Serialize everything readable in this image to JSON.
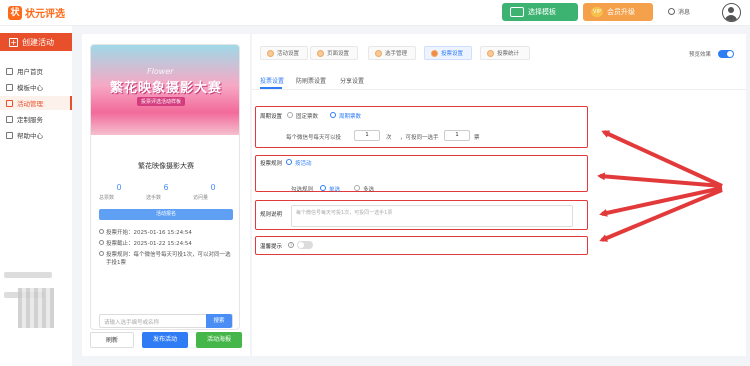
{
  "brand": {
    "name": "状元评选",
    "mark": "状"
  },
  "topbar": {
    "template_btn": "选择模板",
    "vip_btn": "会员升级",
    "vip_badge": "VIP",
    "messages": "消息"
  },
  "sidebar": {
    "create": "创建活动",
    "items": [
      {
        "label": "用户首页"
      },
      {
        "label": "模板中心"
      },
      {
        "label": "活动管理"
      },
      {
        "label": "定制服务"
      },
      {
        "label": "帮助中心"
      }
    ]
  },
  "preview": {
    "flower_text": "Flower",
    "banner_title": "繁花映象摄影大赛",
    "banner_sub": "投票评选活动样板",
    "card_title": "繁花映像摄影大赛",
    "stats": [
      {
        "num": "0",
        "label": "总票数"
      },
      {
        "num": "6",
        "label": "选手数"
      },
      {
        "num": "0",
        "label": "访问量"
      }
    ],
    "vote_btn": "活动报名",
    "start": "投票开始：2025-01-16 15:24:54",
    "end": "投票截止：2025-01-22 15:24:54",
    "rule": "投票规则：每个微信号每天可投1次，可以对同一选手投1票",
    "search_placeholder": "请输入选手编号或名称",
    "search_btn": "搜索",
    "tabs": [
      "首页",
      "排名",
      "我的",
      "规则"
    ]
  },
  "actions": {
    "refresh": "刷新",
    "publish": "发布活动",
    "poster": "活动海报"
  },
  "steps": [
    {
      "label": "活动设置"
    },
    {
      "label": "页面设置"
    },
    {
      "label": "选手管理"
    },
    {
      "label": "投票设置"
    },
    {
      "label": "投票统计"
    }
  ],
  "preview_toggle": "预览效果",
  "subtabs": [
    "投票设置",
    "防刷票设置",
    "分享设置"
  ],
  "form": {
    "cycle_label": "周期设置",
    "cycle_fixed": "固定票数",
    "cycle_period": "周期票数",
    "per_prefix": "每个微信号每天可以投",
    "per_value": "1",
    "per_unit": "次",
    "per_mid": "，可投同一选手",
    "same_value": "1",
    "same_unit": "票",
    "rule_label": "投票规则",
    "rule_option": "按活动",
    "check_label": "勾选规则",
    "single": "单选",
    "multi": "多选",
    "desc_label": "规则说明",
    "desc_placeholder": "每个微信号每天可投1次，可投同一选手1票",
    "warn_label": "温馨提示"
  }
}
